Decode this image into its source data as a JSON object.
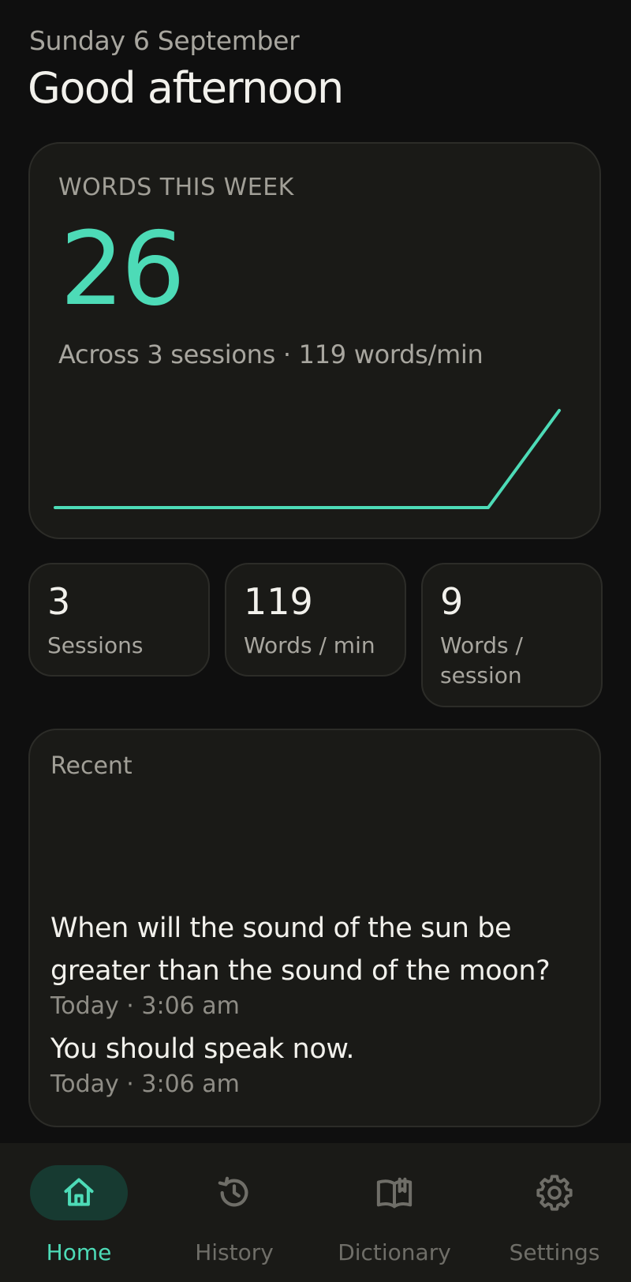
{
  "header": {
    "date": "Sunday 6 September",
    "greeting": "Good afternoon"
  },
  "hero": {
    "label": "WORDS THIS WEEK",
    "value": "26",
    "subtitle": "Across 3 sessions · 119 words/min",
    "accent_color": "#4ddbb7"
  },
  "trend_chart": {
    "type": "line",
    "description_values": [
      0,
      0,
      0,
      0,
      0,
      0,
      26
    ],
    "color": "#4ddbb7"
  },
  "stats": [
    {
      "value": "3",
      "label": "Sessions"
    },
    {
      "value": "119",
      "label": "Words / min"
    },
    {
      "value": "9",
      "label": "Words / session"
    }
  ],
  "recent": {
    "title": "Recent",
    "items": [
      {
        "text": "When will the sound of the sun be greater than the sound of the moon?",
        "time": "Today · 3:06 am"
      },
      {
        "text": "You should speak now.",
        "time": "Today · 3:06 am"
      }
    ]
  },
  "nav": {
    "items": [
      {
        "label": "Home",
        "icon": "home-icon",
        "active": true
      },
      {
        "label": "History",
        "icon": "history-icon",
        "active": false
      },
      {
        "label": "Dictionary",
        "icon": "book-icon",
        "active": false
      },
      {
        "label": "Settings",
        "icon": "gear-icon",
        "active": false
      }
    ],
    "active_color": "#4ddbb7",
    "inactive_color": "#6f6e68"
  }
}
